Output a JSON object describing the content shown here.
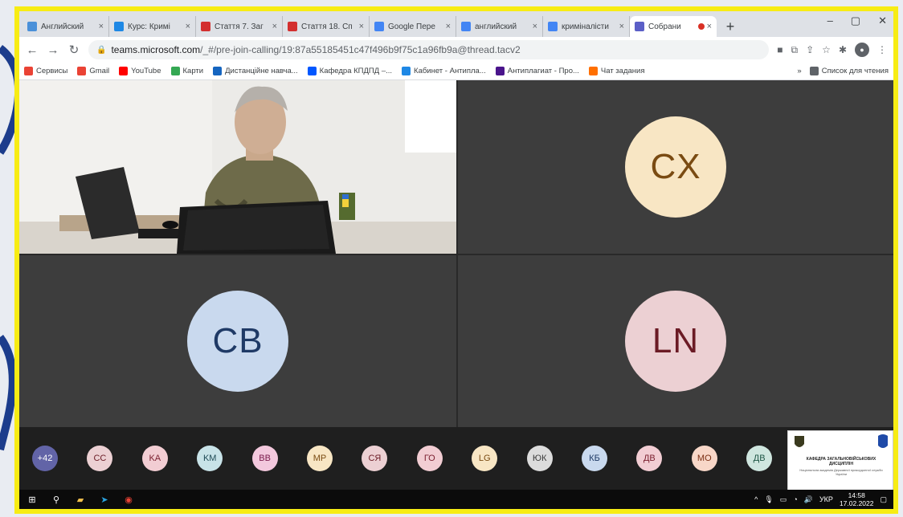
{
  "browser": {
    "tabs": [
      {
        "title": "Английский",
        "color": "#4a90d9",
        "icon": "moodle-icon"
      },
      {
        "title": "Курс: Кримі",
        "color": "#1e88e5",
        "icon": "course-icon"
      },
      {
        "title": "Стаття 7. Заг",
        "color": "#d32f2f",
        "icon": "law-icon"
      },
      {
        "title": "Стаття 18. Сп",
        "color": "#d32f2f",
        "icon": "law-icon"
      },
      {
        "title": "Google Пере",
        "color": "#4285f4",
        "icon": "translate-icon"
      },
      {
        "title": "английский",
        "color": "#4285f4",
        "icon": "google-icon"
      },
      {
        "title": "криміналісти",
        "color": "#4285f4",
        "icon": "google-icon"
      },
      {
        "title": "Собрани",
        "color": "#5b5fc7",
        "icon": "teams-icon",
        "active": true,
        "recording": true
      }
    ],
    "new_tab": "+",
    "url_host": "teams.microsoft.com",
    "url_path": "/_#/pre-join-calling/19:87a55185451c47f496b9f75c1a96fb9a@thread.tacv2",
    "bookmarks": [
      {
        "label": "Сервисы",
        "color": "#ea4335"
      },
      {
        "label": "Gmail",
        "color": "#ea4335"
      },
      {
        "label": "YouTube",
        "color": "#ff0000"
      },
      {
        "label": "Карти",
        "color": "#34a853"
      },
      {
        "label": "Дистанційне навча...",
        "color": "#1565c0"
      },
      {
        "label": "Кафедра КПДПД –...",
        "color": "#0057ff"
      },
      {
        "label": "Кабинет - Антипла...",
        "color": "#1e88e5"
      },
      {
        "label": "Антиплагиат - Про...",
        "color": "#4a148c"
      },
      {
        "label": "Чат задания",
        "color": "#ff6f00"
      }
    ],
    "bookmarks_more": "»",
    "reading_list": "Список для чтения"
  },
  "meeting": {
    "tiles": [
      {
        "initials": "CX",
        "bg": "#f8e6c4",
        "fg": "#7a4b12"
      },
      {
        "initials": "CB",
        "bg": "#c9d9ee",
        "fg": "#1f3a66"
      },
      {
        "initials": "LN",
        "bg": "#ecd0d3",
        "fg": "#6b1b25"
      }
    ],
    "participants": [
      {
        "initials": "+42",
        "bg": "#6264a7",
        "fg": "#ffffff"
      },
      {
        "initials": "CC",
        "bg": "#ecd0d3",
        "fg": "#6b1b25"
      },
      {
        "initials": "KA",
        "bg": "#f2cdd3",
        "fg": "#7a1e2e"
      },
      {
        "initials": "KM",
        "bg": "#c8e3e8",
        "fg": "#1f4b56"
      },
      {
        "initials": "BB",
        "bg": "#f3c8dd",
        "fg": "#7a1a4b"
      },
      {
        "initials": "MP",
        "bg": "#f8e6c4",
        "fg": "#7a4b12"
      },
      {
        "initials": "СЯ",
        "bg": "#ecd0d3",
        "fg": "#6b1b25"
      },
      {
        "initials": "ГО",
        "bg": "#f2cdd3",
        "fg": "#7a1e2e"
      },
      {
        "initials": "LG",
        "bg": "#f8e6c4",
        "fg": "#7a4b12"
      },
      {
        "initials": "ЮК",
        "bg": "#dcdcdc",
        "fg": "#3a3a3a"
      },
      {
        "initials": "КБ",
        "bg": "#c9d9ee",
        "fg": "#1f3a66"
      },
      {
        "initials": "ДВ",
        "bg": "#f2cdd3",
        "fg": "#7a1e2e"
      },
      {
        "initials": "MO",
        "bg": "#f8d7c8",
        "fg": "#7a2e12"
      },
      {
        "initials": "ДВ",
        "bg": "#cfe6df",
        "fg": "#1f5646"
      }
    ],
    "logo_title": "КАФЕДРА ЗАГАЛЬНОВІЙСЬКОВИХ ДИСЦИПЛІН",
    "logo_subtitle": "Національна академія Державної прикордонної служби України"
  },
  "taskbar": {
    "lang": "УКР",
    "time": "14:58",
    "date": "17.02.2022"
  },
  "colors": {
    "frame": "#f7ec14",
    "teams_purple": "#6264a7"
  }
}
